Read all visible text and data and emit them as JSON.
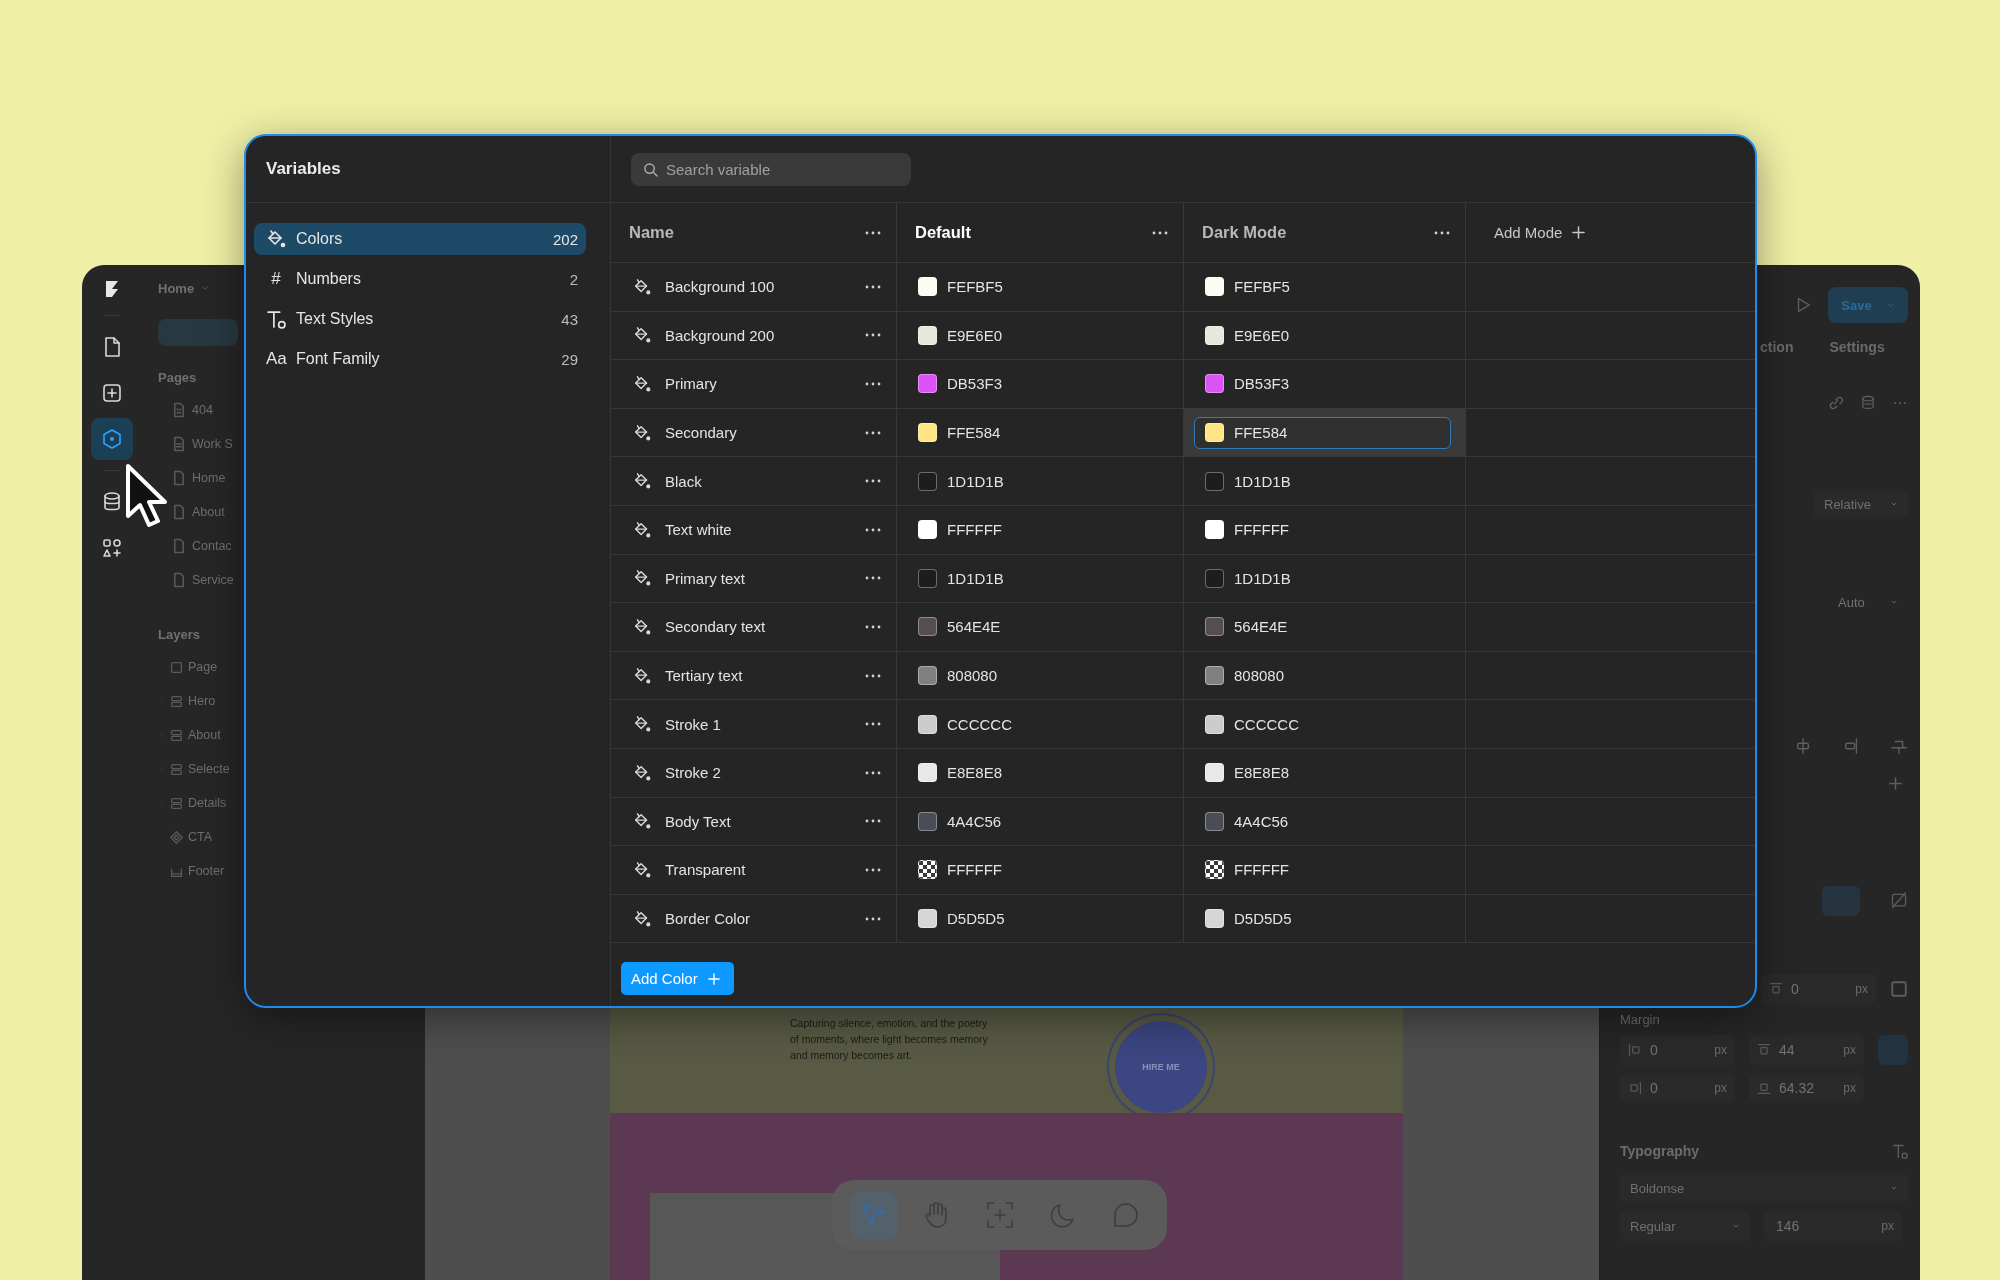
{
  "editor": {
    "breadcrumb": "Home",
    "rail": [
      {
        "kind": "file",
        "selected": false
      },
      {
        "kind": "add",
        "selected": false
      },
      {
        "kind": "component",
        "selected": true
      },
      {
        "kind": "database",
        "selected": false
      },
      {
        "kind": "assets",
        "selected": false
      }
    ],
    "pages_label": "Pages",
    "pages": [
      {
        "label": "404",
        "kind": "error"
      },
      {
        "label": "Work S",
        "kind": "doc"
      },
      {
        "label": "Home",
        "kind": "page"
      },
      {
        "label": "About",
        "kind": "page"
      },
      {
        "label": "Contac",
        "kind": "page"
      },
      {
        "label": "Service",
        "kind": "page"
      }
    ],
    "layers_label": "Layers",
    "layers": [
      {
        "label": "Page",
        "kind": "page"
      },
      {
        "label": "Hero",
        "kind": "stack"
      },
      {
        "label": "About",
        "kind": "stack"
      },
      {
        "label": "Selecte",
        "kind": "stack"
      },
      {
        "label": "Details",
        "kind": "stack"
      },
      {
        "label": "CTA",
        "kind": "component"
      },
      {
        "label": "Footer",
        "kind": "footer"
      }
    ],
    "canvas": {
      "paragraph": "Capturing silence, emotion, and the poetry of moments, where light becomes memory and memory becomes art.",
      "badge": "HIRE ME",
      "tools": [
        {
          "kind": "pointer",
          "selected": true
        },
        {
          "kind": "hand",
          "selected": false
        },
        {
          "kind": "frame",
          "selected": false
        },
        {
          "kind": "moon",
          "selected": false
        },
        {
          "kind": "comment",
          "selected": false
        }
      ]
    },
    "inspector": {
      "save": "Save",
      "tabs": [
        "ction",
        "Settings"
      ],
      "position": "Relative",
      "size": "Auto",
      "padding": {
        "value": "0",
        "unit": "px"
      },
      "margin_label": "Margin",
      "margin": [
        {
          "value": "0",
          "unit": "px"
        },
        {
          "value": "44",
          "unit": "px"
        },
        {
          "value": "0",
          "unit": "px"
        },
        {
          "value": "64.32",
          "unit": "px"
        }
      ],
      "typography_label": "Typography",
      "font": "Boldonse",
      "weight": "Regular",
      "font_size": {
        "value": "146",
        "unit": "px"
      }
    }
  },
  "variables": {
    "title": "Variables",
    "categories": [
      {
        "label": "Colors",
        "count": "202",
        "kind": "colors",
        "selected": true
      },
      {
        "label": "Numbers",
        "count": "2",
        "kind": "glyph",
        "glyph": "#",
        "selected": false
      },
      {
        "label": "Text Styles",
        "count": "43",
        "kind": "text_styles",
        "selected": false
      },
      {
        "label": "Font Family",
        "count": "29",
        "kind": "glyph",
        "glyph": "Aa",
        "selected": false
      }
    ],
    "search": {
      "placeholder": "Search variable"
    },
    "columns": [
      {
        "label": "Name",
        "selected": false
      },
      {
        "label": "Default",
        "selected": true
      },
      {
        "label": "Dark Mode",
        "selected": false
      }
    ],
    "add_mode": "Add Mode",
    "rows": [
      {
        "name": "Background 100",
        "values": [
          {
            "code": "FEFBF5",
            "color": "#fefbf5",
            "kind": "solid",
            "selected": false
          },
          {
            "code": "FEFBF5",
            "color": "#fefbf5",
            "kind": "solid",
            "selected": false
          }
        ]
      },
      {
        "name": "Background 200",
        "values": [
          {
            "code": "E9E6E0",
            "color": "#e9e6e0",
            "kind": "solid",
            "selected": false
          },
          {
            "code": "E9E6E0",
            "color": "#e9e6e0",
            "kind": "solid",
            "selected": false
          }
        ]
      },
      {
        "name": "Primary",
        "values": [
          {
            "code": "DB53F3",
            "color": "#db53f3",
            "kind": "solid",
            "selected": false
          },
          {
            "code": "DB53F3",
            "color": "#db53f3",
            "kind": "solid",
            "selected": false
          }
        ]
      },
      {
        "name": "Secondary",
        "values": [
          {
            "code": "FFE584",
            "color": "#ffe584",
            "kind": "solid",
            "selected": false
          },
          {
            "code": "FFE584",
            "color": "#ffe584",
            "kind": "solid",
            "selected": true
          }
        ]
      },
      {
        "name": "Black",
        "values": [
          {
            "code": "1D1D1B",
            "color": "#1d1d1b",
            "kind": "solid",
            "selected": false
          },
          {
            "code": "1D1D1B",
            "color": "#1d1d1b",
            "kind": "solid",
            "selected": false
          }
        ]
      },
      {
        "name": "Text white",
        "values": [
          {
            "code": "FFFFFF",
            "color": "#ffffff",
            "kind": "solid",
            "selected": false
          },
          {
            "code": "FFFFFF",
            "color": "#ffffff",
            "kind": "solid",
            "selected": false
          }
        ]
      },
      {
        "name": "Primary text",
        "values": [
          {
            "code": "1D1D1B",
            "color": "#1d1d1b",
            "kind": "solid",
            "selected": false
          },
          {
            "code": "1D1D1B",
            "color": "#1d1d1b",
            "kind": "solid",
            "selected": false
          }
        ]
      },
      {
        "name": "Secondary text",
        "values": [
          {
            "code": "564E4E",
            "color": "#564e4e",
            "kind": "solid",
            "selected": false
          },
          {
            "code": "564E4E",
            "color": "#564e4e",
            "kind": "solid",
            "selected": false
          }
        ]
      },
      {
        "name": "Tertiary text",
        "values": [
          {
            "code": "808080",
            "color": "#808080",
            "kind": "solid",
            "selected": false
          },
          {
            "code": "808080",
            "color": "#808080",
            "kind": "solid",
            "selected": false
          }
        ]
      },
      {
        "name": "Stroke 1",
        "values": [
          {
            "code": "CCCCCC",
            "color": "#cccccc",
            "kind": "solid",
            "selected": false
          },
          {
            "code": "CCCCCC",
            "color": "#cccccc",
            "kind": "solid",
            "selected": false
          }
        ]
      },
      {
        "name": "Stroke 2",
        "values": [
          {
            "code": "E8E8E8",
            "color": "#e8e8e8",
            "kind": "solid",
            "selected": false
          },
          {
            "code": "E8E8E8",
            "color": "#e8e8e8",
            "kind": "solid",
            "selected": false
          }
        ]
      },
      {
        "name": "Body Text",
        "values": [
          {
            "code": "4A4C56",
            "color": "#4a4c56",
            "kind": "solid",
            "selected": false
          },
          {
            "code": "4A4C56",
            "color": "#4a4c56",
            "kind": "solid",
            "selected": false
          }
        ]
      },
      {
        "name": "Transparent",
        "values": [
          {
            "code": "FFFFFF",
            "color": "#ffffff",
            "kind": "transparent",
            "selected": false
          },
          {
            "code": "FFFFFF",
            "color": "#ffffff",
            "kind": "transparent",
            "selected": false
          }
        ]
      },
      {
        "name": "Border Color",
        "values": [
          {
            "code": "D5D5D5",
            "color": "#d5d5d5",
            "kind": "solid",
            "selected": false
          },
          {
            "code": "D5D5D5",
            "color": "#d5d5d5",
            "kind": "solid",
            "selected": false
          }
        ]
      }
    ],
    "add_button": "Add Color"
  }
}
